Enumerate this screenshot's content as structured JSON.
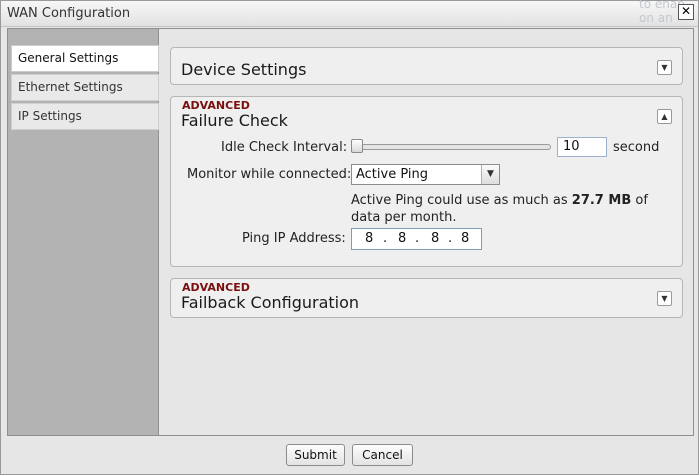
{
  "window": {
    "title": "WAN Configuration",
    "close_symbol": "✕",
    "background_text": [
      "to enab",
      "on an"
    ]
  },
  "sidebar": {
    "items": [
      {
        "label": "General Settings",
        "active": true
      },
      {
        "label": "Ethernet Settings",
        "active": false
      },
      {
        "label": "IP Settings",
        "active": false
      }
    ]
  },
  "device_settings": {
    "title": "Device Settings",
    "toggle_icon": "chevron-down-icon",
    "toggle_symbol": "▼"
  },
  "failure_check": {
    "badge": "ADVANCED",
    "title": "Failure Check",
    "toggle_icon": "chevron-up-icon",
    "toggle_symbol": "▲",
    "idle_check_interval": {
      "label": "Idle Check Interval:",
      "value": "10",
      "unit": "second",
      "slider_level": 0
    },
    "monitor": {
      "label": "Monitor while connected:",
      "selected": "Active Ping",
      "arrow_symbol": "▼"
    },
    "note": {
      "prefix": "Active Ping could use as much as ",
      "amount": "27.7 MB",
      "suffix": " of data per month."
    },
    "ping_ip": {
      "label": "Ping IP Address:",
      "octets": [
        "8",
        "8",
        "8",
        "8"
      ],
      "dot": "."
    }
  },
  "failback": {
    "badge": "ADVANCED",
    "title": "Failback Configuration",
    "toggle_icon": "chevron-down-icon",
    "toggle_symbol": "▼"
  },
  "footer": {
    "submit_label": "Submit",
    "cancel_label": "Cancel"
  },
  "colors": {
    "advanced_badge": "#7a0f0f",
    "sidebar_bg": "#b3b3b3",
    "panel_bg": "#efefef",
    "input_border": "#7f9db9"
  }
}
